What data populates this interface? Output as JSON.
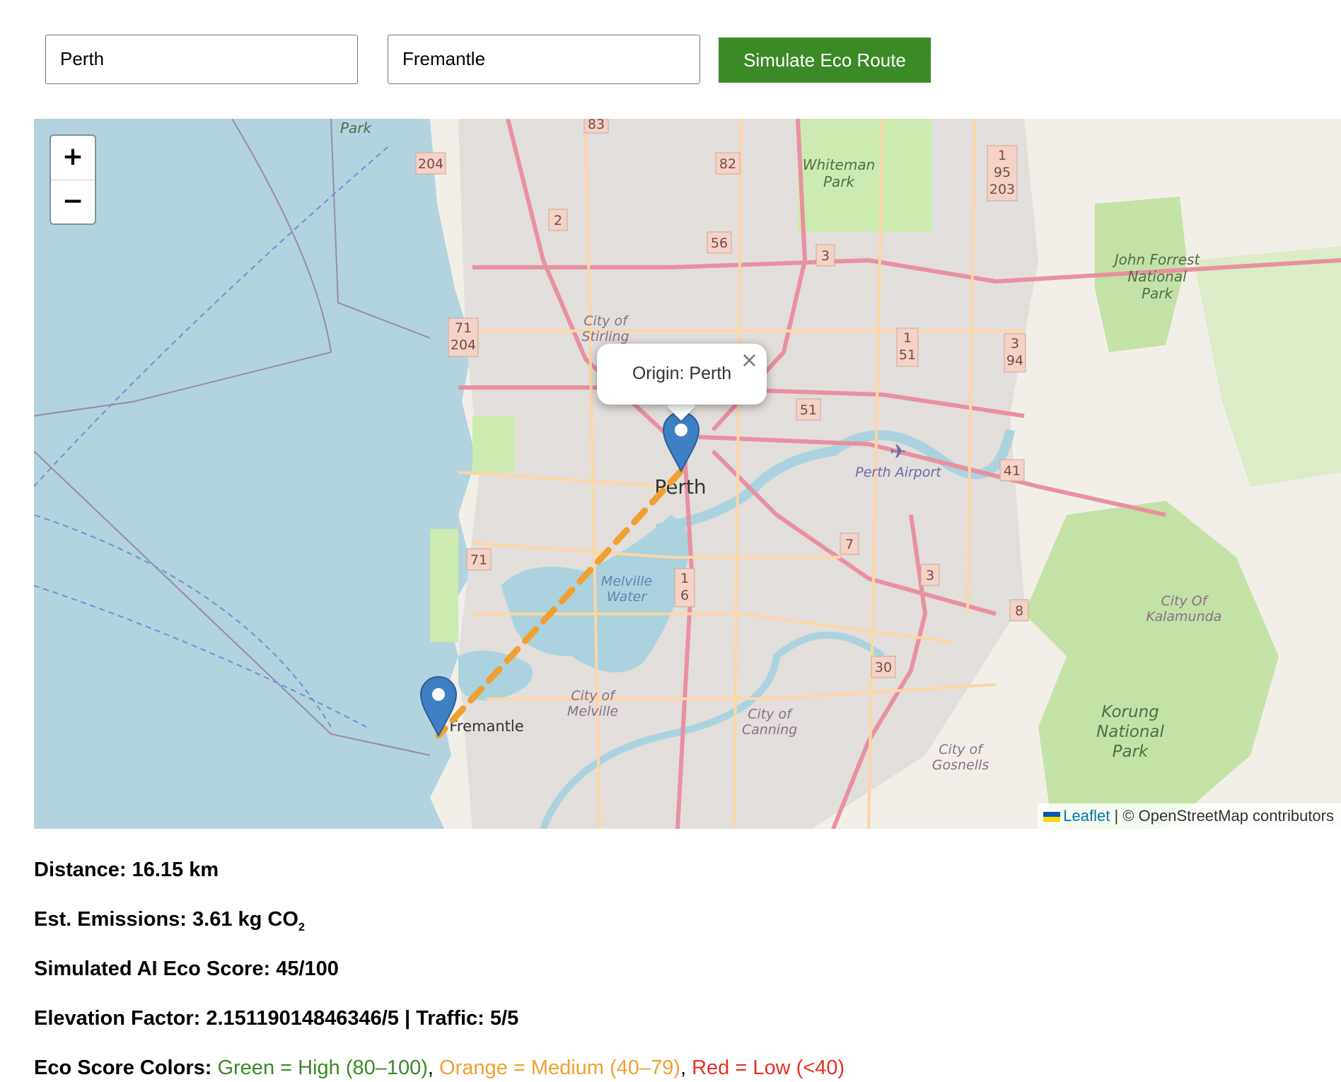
{
  "form": {
    "origin_value": "Perth",
    "destination_value": "Fremantle",
    "simulate_label": "Simulate Eco Route"
  },
  "map": {
    "zoom_in": "+",
    "zoom_out": "−",
    "popup_text": "Origin: Perth",
    "popup_close": "×",
    "attribution_link": "Leaflet",
    "attribution_text": "| © OpenStreetMap contributors",
    "places": {
      "park_top": "Park",
      "whiteman": "Whiteman",
      "whiteman2": "Park",
      "city_stirling": "City of",
      "city_stirling2": "Stirling",
      "perth": "Perth",
      "perth_airport": "Perth Airport",
      "melville_water": "Melville",
      "melville_water2": "Water",
      "city_melville": "City of",
      "city_melville2": "Melville",
      "fremantle": "Fremantle",
      "city_canning": "City of",
      "city_canning2": "Canning",
      "city_gosnells": "City of",
      "city_gosnells2": "Gosnells",
      "john_forrest": "John Forrest",
      "john_forrest2": "National",
      "john_forrest3": "Park",
      "kalamunda": "City Of",
      "kalamunda2": "Kalamunda",
      "korung": "Korung",
      "korung2": "National",
      "korung3": "Park"
    },
    "shields": [
      "83",
      "204",
      "82",
      "2",
      "56",
      "3",
      "71",
      "204",
      "1",
      "51",
      "3",
      "94",
      "51",
      "41",
      "71",
      "7",
      "3",
      "1",
      "6",
      "8",
      "30",
      "1",
      "95",
      "203"
    ]
  },
  "stats": {
    "distance_label": "Distance:",
    "distance_value": "16.15 km",
    "emissions_label": "Est. Emissions:",
    "emissions_value": "3.61 kg CO",
    "emissions_sub": "2",
    "score_label": "Simulated AI Eco Score:",
    "score_value": "45/100",
    "elevation_label": "Elevation Factor:",
    "elevation_value": "2.15119014846346/5",
    "traffic_label": "| Traffic:",
    "traffic_value": "5/5",
    "legend_label": "Eco Score Colors:",
    "legend_green": "Green = High (80–100)",
    "legend_orange": "Orange = Medium (40–79)",
    "legend_red": "Red = Low (<40)",
    "sep": ","
  },
  "colors": {
    "button": "#3a8a26",
    "route": "#f0a030",
    "marker": "#3f7fc4",
    "high": "#3a8a26",
    "medium": "#f0a030",
    "low": "#e53020"
  }
}
